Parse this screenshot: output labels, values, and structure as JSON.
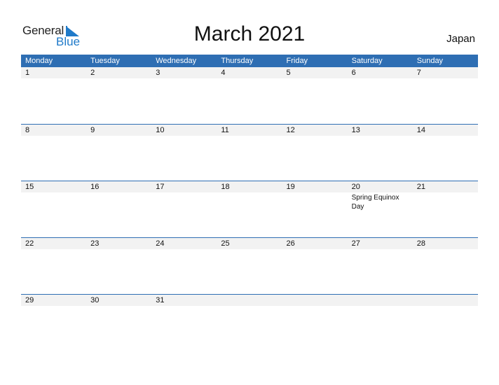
{
  "logo": {
    "word1": "General",
    "word2": "Blue"
  },
  "title": "March 2021",
  "country": "Japan",
  "weekdays": [
    "Monday",
    "Tuesday",
    "Wednesday",
    "Thursday",
    "Friday",
    "Saturday",
    "Sunday"
  ],
  "weeks": [
    {
      "days": [
        "1",
        "2",
        "3",
        "4",
        "5",
        "6",
        "7"
      ],
      "events": [
        "",
        "",
        "",
        "",
        "",
        "",
        ""
      ]
    },
    {
      "days": [
        "8",
        "9",
        "10",
        "11",
        "12",
        "13",
        "14"
      ],
      "events": [
        "",
        "",
        "",
        "",
        "",
        "",
        ""
      ]
    },
    {
      "days": [
        "15",
        "16",
        "17",
        "18",
        "19",
        "20",
        "21"
      ],
      "events": [
        "",
        "",
        "",
        "",
        "",
        "Spring Equinox Day",
        ""
      ]
    },
    {
      "days": [
        "22",
        "23",
        "24",
        "25",
        "26",
        "27",
        "28"
      ],
      "events": [
        "",
        "",
        "",
        "",
        "",
        "",
        ""
      ]
    },
    {
      "days": [
        "29",
        "30",
        "31",
        "",
        "",
        "",
        ""
      ],
      "events": [
        "",
        "",
        "",
        "",
        "",
        "",
        ""
      ]
    }
  ],
  "colors": {
    "header_bg": "#2e6eb3",
    "date_strip_bg": "#f2f2f2",
    "brand_blue": "#1f7ac9"
  }
}
